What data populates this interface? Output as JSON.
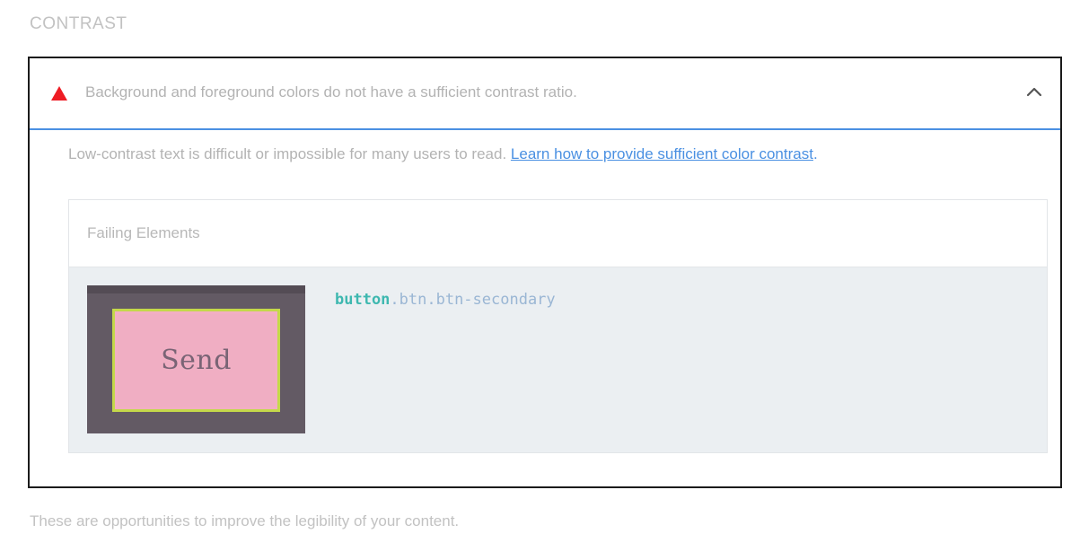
{
  "section": {
    "title": "CONTRAST"
  },
  "audit": {
    "status_icon": "warning-triangle-icon",
    "status_color": "#ee1c24",
    "title": "Background and foreground colors do not have a sufficient contrast ratio.",
    "expand_icon": "chevron-up-icon",
    "description": "Low-contrast text is difficult or impossible for many users to read.",
    "link_text": "Learn how to provide sufficient color contrast",
    "link_suffix": ".",
    "accent_color": "#4a90e2"
  },
  "failing_elements": {
    "title": "Failing Elements",
    "items": [
      {
        "thumbnail_label": "Send",
        "selector_tag": "button",
        "selector_classes": ".btn.btn-secondary"
      }
    ]
  },
  "footer": {
    "note": "These are opportunities to improve the legibility of your content."
  }
}
